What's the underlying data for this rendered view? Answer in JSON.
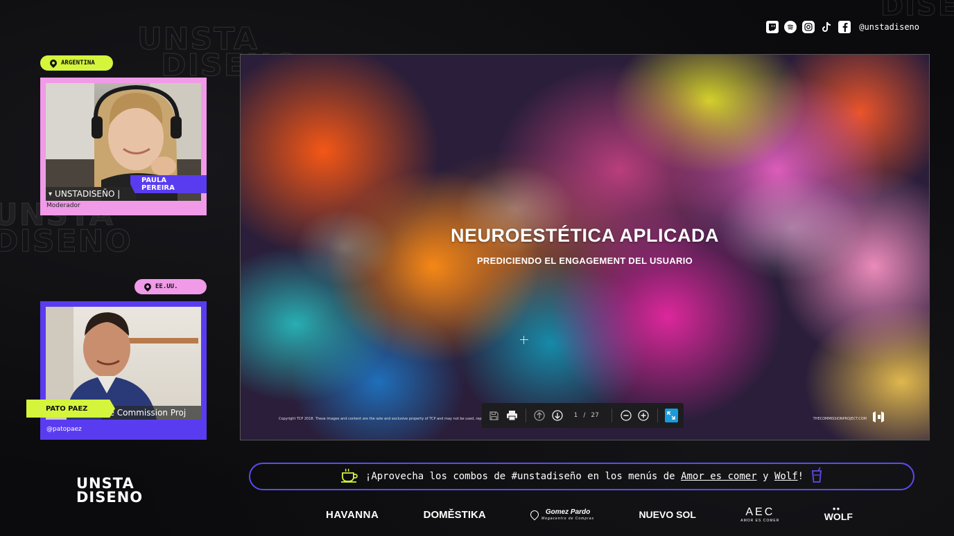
{
  "social": {
    "icons": [
      "twitch-icon",
      "spotify-icon",
      "instagram-icon",
      "tiktok-icon",
      "facebook-icon"
    ],
    "handle": "@unstadiseno"
  },
  "speakers": [
    {
      "location": "ARGENTINA",
      "name": "PAULA PEREIRA",
      "role": "Moderador",
      "video_label": "UNSTADISEÑO |",
      "tag_color": "#d4f53c",
      "card_color": "#f09ae8",
      "name_color": "#5a3cf0"
    },
    {
      "location": "EE.UU.",
      "name": "PATO PAEZ",
      "role": "@patopaez",
      "video_label": "he Commission Proj",
      "tag_color": "#f09ae8",
      "card_color": "#5a3cf0",
      "name_color": "#d4f53c"
    }
  ],
  "slide": {
    "title": "NEUROESTÉTICA APLICADA",
    "subtitle": "PREDICIENDO EL ENGAGEMENT DEL USUARIO",
    "copyright": "Copyright TCP 2018. These images and content are the sole and exclusive property of TCP and may not be used, reproduced, or replicated in any manner",
    "site": "THECOMMISSIONPROJECT.COM"
  },
  "pdf_toolbar": {
    "current_page": "1",
    "separator": "/",
    "total_pages": "27"
  },
  "announcement": {
    "prefix": "¡Aprovecha los combos de #unstadiseño en los menús de",
    "link1": "Amor es comer",
    "mid": "y",
    "link2": "Wolf",
    "suffix": "!"
  },
  "logo": {
    "line1": "UNSTA",
    "line2": "DISENO"
  },
  "sponsors": [
    {
      "name": "HAVANNA",
      "sub": ""
    },
    {
      "name": "DOMĚSTIKA",
      "sub": ""
    },
    {
      "name": "Gomez Pardo",
      "sub": "Megacentro de Compras"
    },
    {
      "name": "NUEVO SOL",
      "sub": ""
    },
    {
      "name": "AEC",
      "sub": "AMOR ES COMER"
    },
    {
      "name": "WOLF",
      "sub": ""
    }
  ],
  "colors": {
    "lime": "#d4f53c",
    "pink": "#f09ae8",
    "violet": "#5a3cf0",
    "accent_blue": "#1a9bdc"
  }
}
